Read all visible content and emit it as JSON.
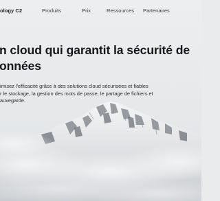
{
  "nav": {
    "brand": "ology C2",
    "items": [
      "Produits",
      "Prix",
      "Ressources",
      "Partenaires"
    ]
  },
  "hero": {
    "title": "n cloud qui garantit la sécurité de\nonnées",
    "text": "imisez l'efficacité grâce à des solutions cloud sécurisées et fiables\nr le stockage, la gestion des mots de passe, le partage de fichiers et\nauvegarde."
  },
  "colors": {
    "background": "#e9ebed",
    "title": "#16181c",
    "mountain_rock": "#6f747a"
  }
}
